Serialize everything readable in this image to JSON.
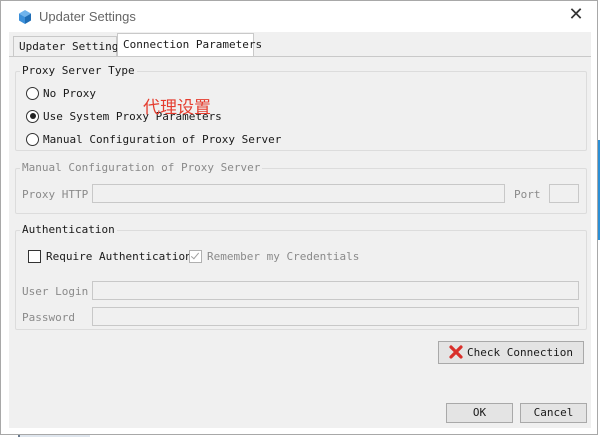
{
  "window": {
    "title": "Updater Settings"
  },
  "tabs": [
    {
      "label": "Updater Settings",
      "active": false
    },
    {
      "label": "Connection Parameters",
      "active": true
    }
  ],
  "annotation": "代理设置",
  "proxy_type": {
    "label": "Proxy Server Type",
    "options": [
      {
        "label": "No Proxy",
        "selected": false
      },
      {
        "label": "Use System Proxy Parameters",
        "selected": true
      },
      {
        "label": "Manual Configuration of Proxy Server",
        "selected": false
      }
    ]
  },
  "manual_config": {
    "label": "Manual Configuration of Proxy Server",
    "proxy_label": "Proxy HTTP",
    "proxy_value": "",
    "port_label": "Port",
    "port_value": ""
  },
  "authentication": {
    "label": "Authentication",
    "require_label": "Require Authentication",
    "require_checked": false,
    "remember_label": "Remember my Credentials",
    "remember_checked": true,
    "login_label": "User Login",
    "login_value": "",
    "password_label": "Password",
    "password_value": ""
  },
  "buttons": {
    "check_connection": "Check Connection",
    "ok": "OK",
    "cancel": "Cancel"
  },
  "colors": {
    "annotation": "#e53c2e",
    "check_icon": "#d9302b",
    "app_icon": "#3b8fd9"
  },
  "icons": {
    "app": "cube-icon",
    "close": "close-icon",
    "check": "red-x-icon"
  }
}
